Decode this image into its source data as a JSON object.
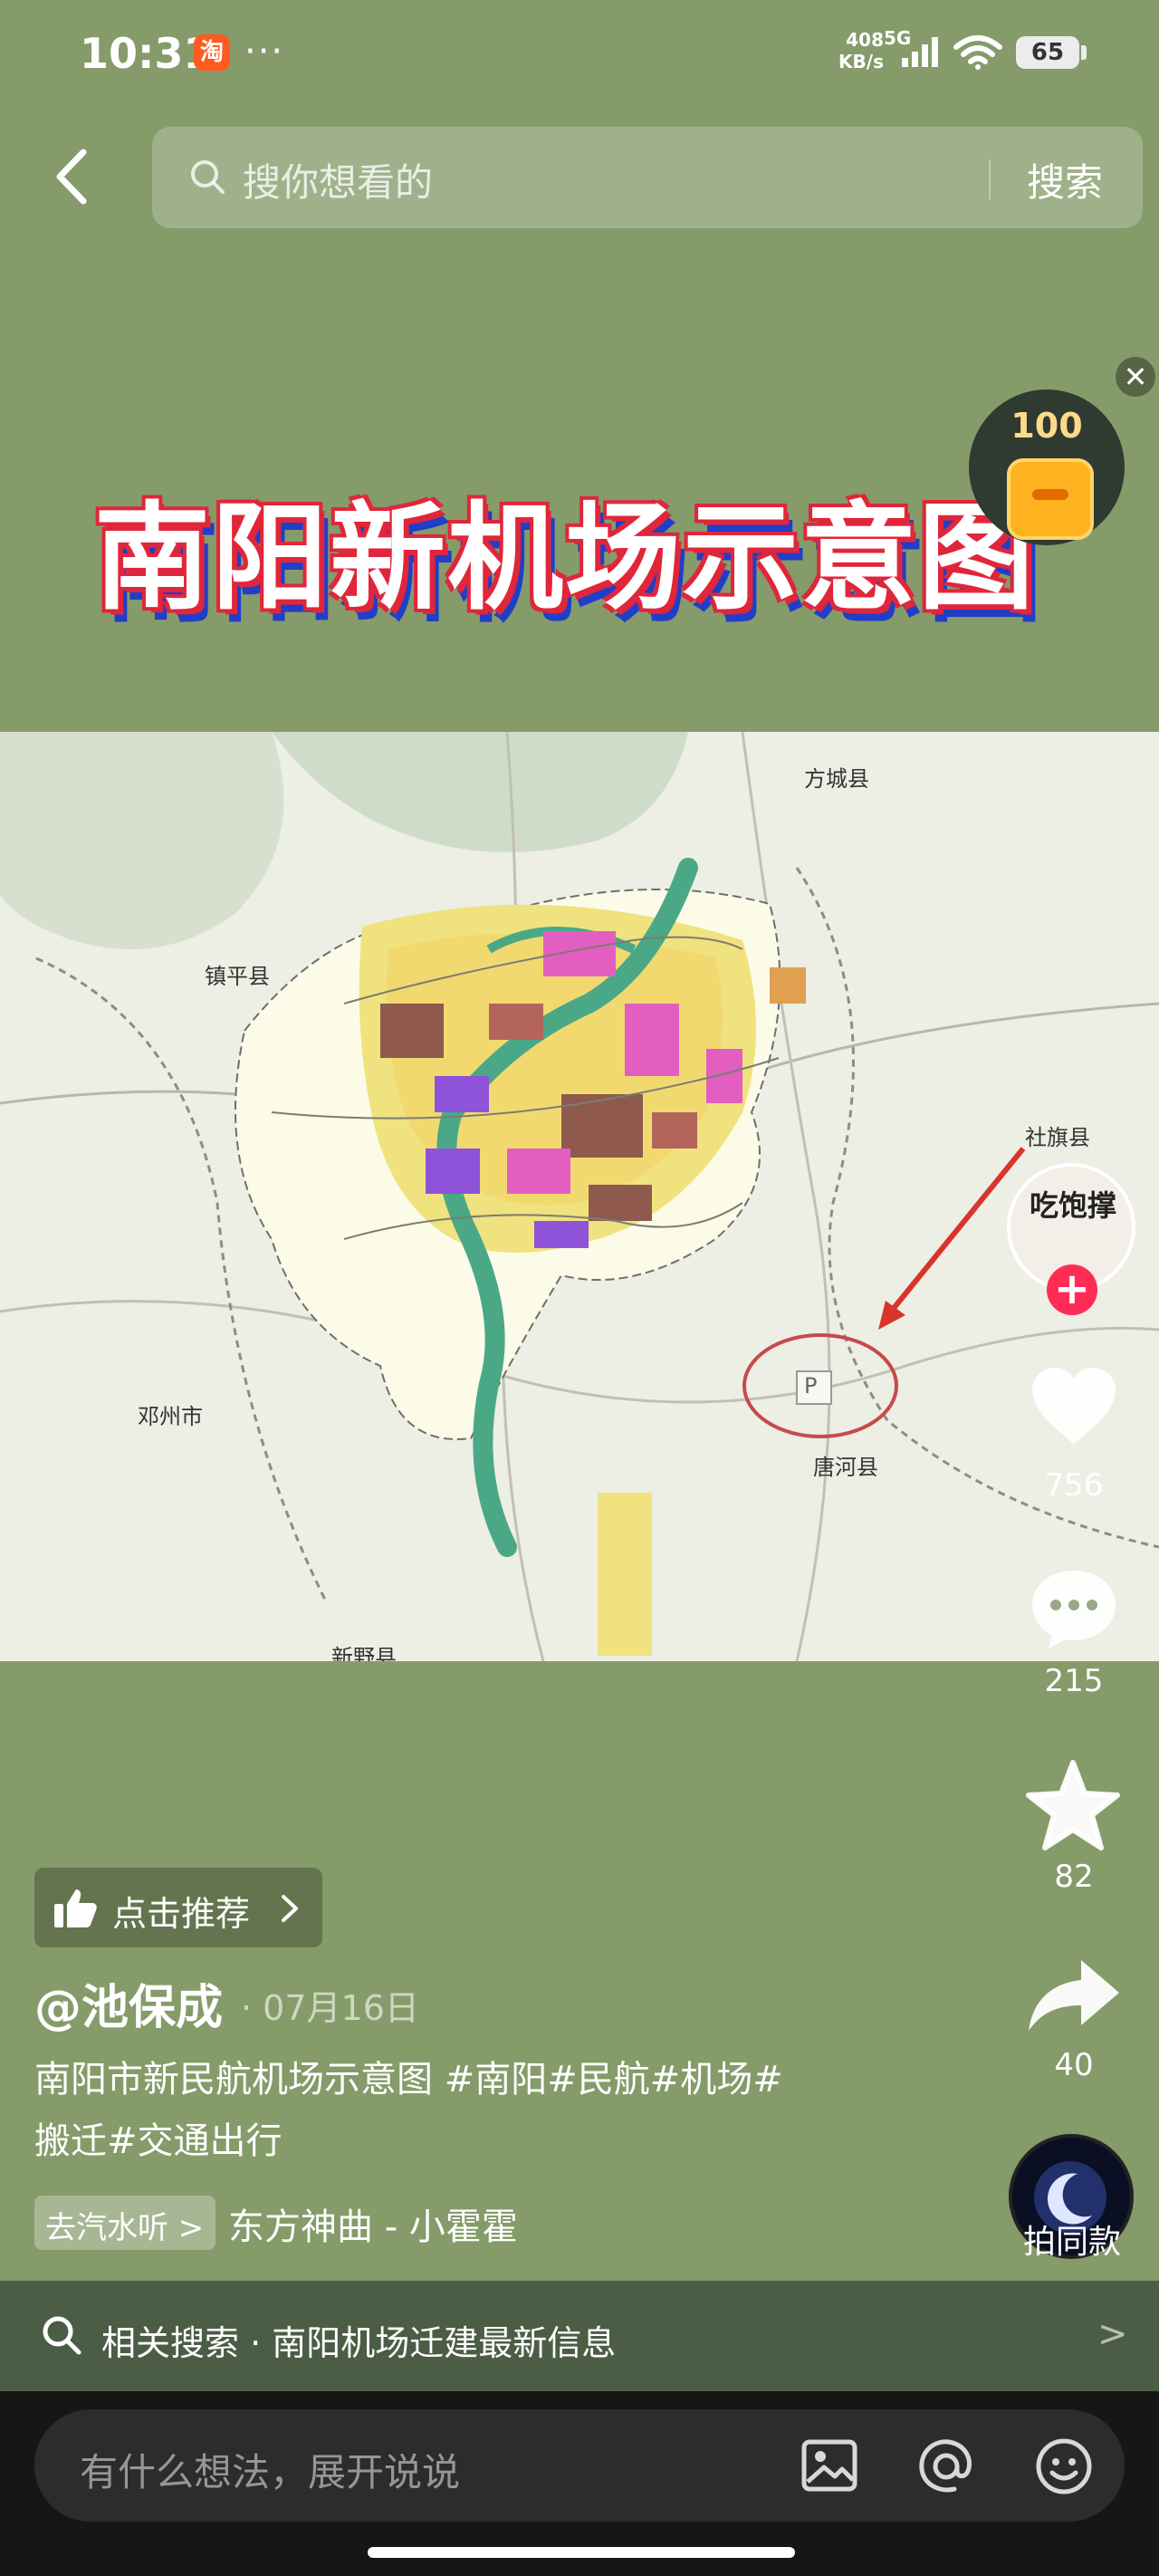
{
  "status_bar": {
    "time": "10:31",
    "taobao_glyph": "淘",
    "more": "···",
    "net_speed_value": "408",
    "net_speed_unit": "KB/s",
    "net_type": "5G",
    "battery": "65"
  },
  "search": {
    "placeholder": "搜你想看的",
    "button_label": "搜索"
  },
  "video": {
    "title": "南阳新机场示意图",
    "map_labels": {
      "fangcheng": "方城县",
      "zhenping": "镇平县",
      "sheqi": "社旗县",
      "dengzhou": "邓州市",
      "tanghe": "唐河县",
      "parking_marker": "P",
      "xinye": "新野县"
    }
  },
  "red_packet": {
    "count": "100",
    "close_glyph": "✕"
  },
  "author_avatar": {
    "text": "吃饱撑",
    "follow_glyph": "+"
  },
  "actions": {
    "likes": "756",
    "comments": "215",
    "favorites": "82",
    "shares": "40"
  },
  "post": {
    "recommend_label": "点击推荐",
    "author": "@池保成",
    "date": "· 07月16日",
    "caption_line1": "南阳市新民航机场示意图 #南阳#民航#机场#",
    "caption_line2": "搬迁#交通出行",
    "music_badge": "去汽水听 >",
    "music_name": "东方神曲 - 小霍霍",
    "same_style_label": "拍同款"
  },
  "related": {
    "text": "相关搜索 · 南阳机场迁建最新信息",
    "chevron": ">"
  },
  "comment_bar": {
    "placeholder": "有什么想法，展开说说"
  },
  "icons": {
    "back": "back-arrow-icon",
    "search": "search-icon",
    "like": "heart-icon",
    "comment": "comment-bubble-icon",
    "favorite": "star-icon",
    "share": "share-arrow-icon",
    "image": "image-icon",
    "mention": "at-icon",
    "emoji": "emoji-icon"
  }
}
